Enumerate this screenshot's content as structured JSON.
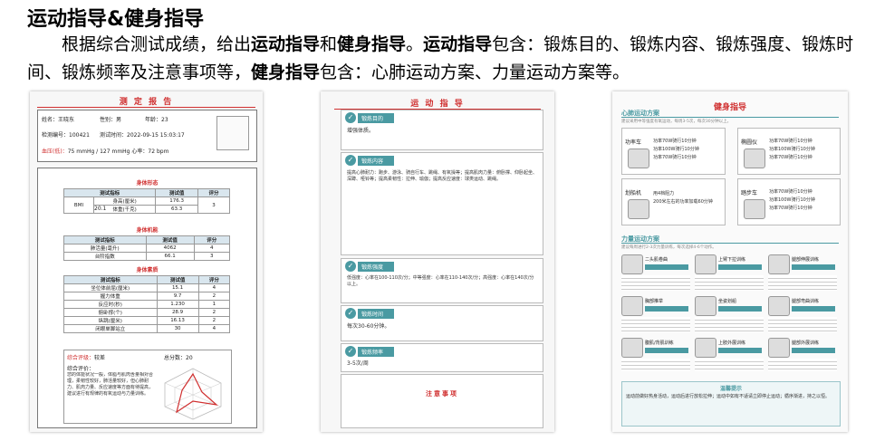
{
  "heading": "运动指导&健身指导",
  "intro": {
    "p1": "根据综合测试成绩，给出",
    "k1": "运动指导",
    "p2": "和",
    "k2": "健身指导",
    "p3": "。",
    "k3": "运动指导",
    "p4": "包含：锻炼目的、锻炼内容、锻炼强度、锻炼时间、锻炼频率及注意事项等，",
    "k4": "健身指导",
    "p5": "包含：心肺运动方案、力量运动方案等。"
  },
  "report1": {
    "title": "测 定 报 告",
    "name_label": "姓名：",
    "name": "王晓东",
    "sex_label": "性别：",
    "sex": "男",
    "age_label": "年龄：",
    "age": "23",
    "id_label": "检测编号：",
    "id": "100421",
    "time_label": "测试时间：",
    "time": "2022-09-15 15:03:17",
    "bp_label": "血压(低)：",
    "bp_low": "75",
    "bp_high": "127",
    "bp_unit": "mmHg",
    "hr": "心率：72 bpm",
    "sec1": "身体形态",
    "sec1_cols": [
      "测试指标",
      "测试值",
      "评分"
    ],
    "sec1_rows": [
      [
        "BMI",
        "20.1",
        "身高(厘米)",
        "176.3",
        "3"
      ],
      [
        "",
        "",
        "体重(千克)",
        "63.3",
        ""
      ]
    ],
    "sec2": "身体机能",
    "sec2_rows": [
      [
        "肺活量(毫升)",
        "4062",
        "4"
      ],
      [
        "台阶指数",
        "66.1",
        "3"
      ]
    ],
    "sec3": "身体素质",
    "sec3_rows": [
      [
        "坐位体前屈(厘米)",
        "15.1",
        "4"
      ],
      [
        "握力体重",
        "9.7",
        "2"
      ],
      [
        "反应时(秒)",
        "1.230",
        "1"
      ],
      [
        "俯卧撑(个)",
        "28.9",
        "2"
      ],
      [
        "纵跳(厘米)",
        "16.13",
        "2"
      ],
      [
        "闭眼单脚站立",
        "30",
        "4"
      ]
    ],
    "grade_label": "综合评级：",
    "grade": "较差",
    "score_label": "总分数：",
    "score": "20",
    "eval_label": "综合评价：",
    "eval_text": "您的体能状况一般，体脂与肌肉含量相对合理，柔韧性较好，肺活量较好，但心肺耐力、肌肉力量、反应速度等方面有待提高，建议进行有规律的有氧运动与力量训练。"
  },
  "report2": {
    "title": "运 动 指 导",
    "s1": "锻炼目的",
    "s1_text": "增强体质。",
    "s2": "锻炼内容",
    "s2_text": "提高心肺耐力：跑步、游泳、骑自行车、跳绳、有氧操等；提高肌肉力量：俯卧撑、仰卧起坐、深蹲、哑铃等；提高柔韧性：拉伸、瑜伽；提高反应速度：球类运动、跳绳。",
    "s3": "锻炼强度",
    "s3_text": "低强度：心率在100-110次/分；中等强度：心率在110-140次/分；高强度：心率在140次/分以上。",
    "s4": "锻炼时间",
    "s4_text": "每次30-60分钟。",
    "s5": "锻炼频率",
    "s5_text": "3-5次/周",
    "s6": "注意事项"
  },
  "report3": {
    "title": "健身指导",
    "cardio_label": "心肺运动方案",
    "cardio_note": "建议采用中等强度有氧运动，每周3-5次，每次30分钟以上。",
    "cardio": [
      {
        "name": "功率车",
        "lines": [
          "功率70W骑行10分钟",
          "功率100W骑行10分钟",
          "功率70W骑行10分钟"
        ]
      },
      {
        "name": "椭圆仪",
        "lines": [
          "功率70W骑行10分钟",
          "功率100W骑行10分钟",
          "功率70W骑行10分钟"
        ]
      },
      {
        "name": "划船机",
        "lines": [
          "用4档阻力",
          "200米左右的功率加载60分钟"
        ]
      },
      {
        "name": "踏步车",
        "lines": [
          "功率70W骑行10分钟",
          "功率100W骑行10分钟",
          "功率70W骑行10分钟"
        ]
      }
    ],
    "strength_label": "力量运动方案",
    "strength_note": "建议每周进行2-3次力量训练，每次选择4-6个动作。",
    "strength": [
      "二头肌卷曲",
      "上臂下拉训练",
      "腿部伸展训练",
      "胸部推举",
      "坐姿划船",
      "腿部弯曲训练",
      "腹肌/背肌训练",
      "上肢外展训练",
      "腿部外展训练"
    ],
    "tips_label": "温馨提示",
    "tips_text": "运动前做好热身活动，运动后进行放松拉伸；运动中如有不适请立即停止运动；循序渐进，持之以恒。"
  }
}
